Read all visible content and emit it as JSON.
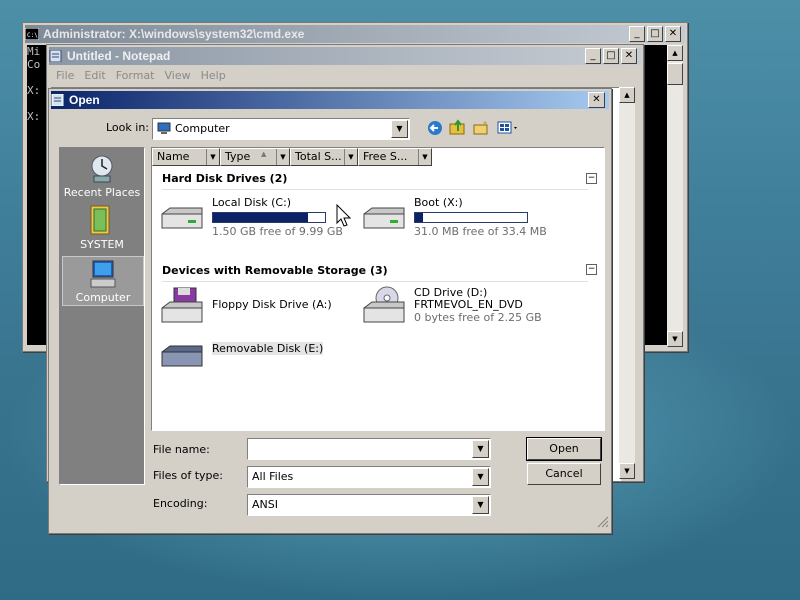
{
  "cmd": {
    "title": "Administrator: X:\\windows\\system32\\cmd.exe",
    "lines": [
      "Mi",
      "Co",
      "",
      "X:",
      "",
      "X:"
    ]
  },
  "notepad": {
    "title": "Untitled - Notepad",
    "menu": [
      "File",
      "Edit",
      "Format",
      "View",
      "Help"
    ]
  },
  "dialog": {
    "title": "Open",
    "look_in_label": "Look in:",
    "look_in_value": "Computer",
    "places": [
      "Recent Places",
      "SYSTEM",
      "Computer"
    ],
    "columns": [
      "Name",
      "Type",
      "Total S...",
      "Free S..."
    ],
    "groups": [
      {
        "label": "Hard Disk Drives (2)",
        "items": [
          {
            "name": "Local Disk (C:)",
            "detail": "1.50 GB free of 9.99 GB",
            "used_fraction": 0.85
          },
          {
            "name": "Boot (X:)",
            "detail": "31.0 MB free of 33.4 MB",
            "used_fraction": 0.07
          }
        ]
      },
      {
        "label": "Devices with Removable Storage (3)",
        "items": [
          {
            "name": "Floppy Disk Drive (A:)"
          },
          {
            "name": "CD Drive (D:)",
            "line2": "FRTMEVOL_EN_DVD",
            "detail": "0 bytes free of 2.25 GB"
          },
          {
            "name": "Removable Disk (E:)"
          }
        ]
      }
    ],
    "file_name_label": "File name:",
    "file_name_value": "",
    "file_type_label": "Files of type:",
    "file_type_value": "All Files",
    "encoding_label": "Encoding:",
    "encoding_value": "ANSI",
    "open_label": "Open",
    "cancel_label": "Cancel"
  },
  "colors": {
    "progress_fill": "#0b2366",
    "active_title": "#0a246a"
  }
}
